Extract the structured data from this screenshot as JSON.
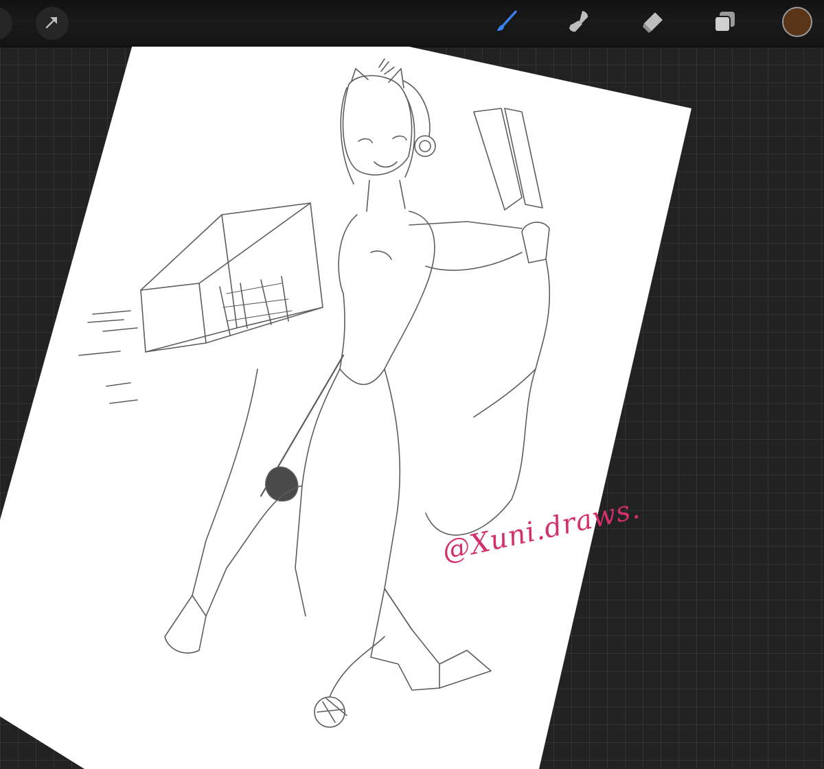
{
  "toolbar": {
    "left_tools": [
      {
        "name": "gallery-icon",
        "active": false
      },
      {
        "name": "transform-arrow-icon",
        "active": false
      }
    ],
    "right_tools": [
      {
        "name": "brush-icon",
        "active": true
      },
      {
        "name": "smudge-icon",
        "active": false
      },
      {
        "name": "eraser-icon",
        "active": false
      },
      {
        "name": "layers-icon",
        "active": false
      }
    ],
    "current_color": "#5a3417"
  },
  "canvas": {
    "watermark": "@Xuni.draws.",
    "watermark_color": "#d2306d",
    "paper_color": "#ffffff",
    "sketch_color": "#5c5c5c",
    "workspace_color": "#222222",
    "accent_color": "#3b82f6"
  }
}
